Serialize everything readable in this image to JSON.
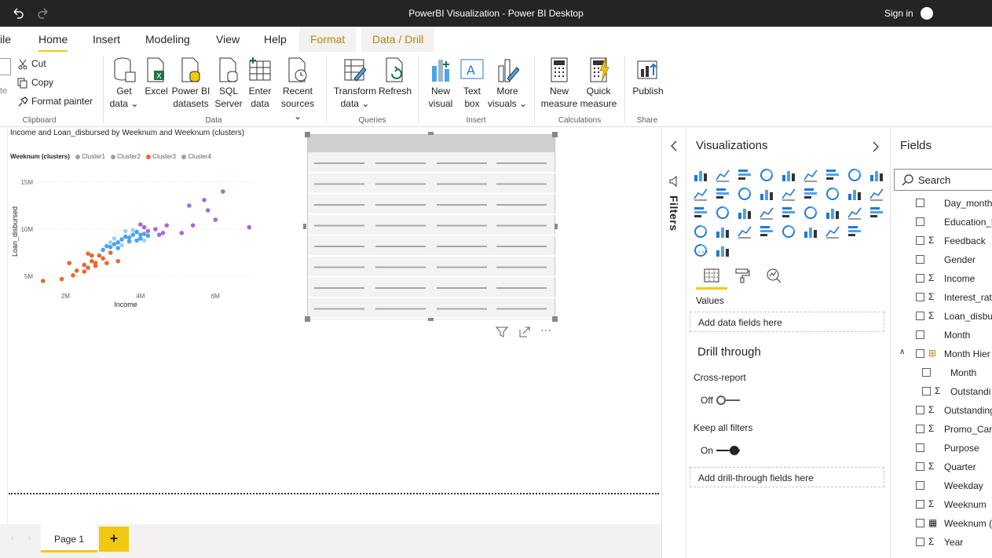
{
  "window": {
    "title": "PowerBI Visualization - Power BI Desktop",
    "sign_in": "Sign in"
  },
  "tabs": {
    "file": "ile",
    "home": "Home",
    "insert": "Insert",
    "modeling": "Modeling",
    "view": "View",
    "help": "Help",
    "format": "Format",
    "data_drill": "Data / Drill"
  },
  "ribbon": {
    "paste": "te",
    "cut": "Cut",
    "copy": "Copy",
    "format_painter": "Format painter",
    "get_data": "Get",
    "get_data2": "data",
    "excel": "Excel",
    "pbi_datasets": "Power BI",
    "pbi_datasets2": "datasets",
    "sql": "SQL",
    "sql2": "Server",
    "enter_data": "Enter",
    "enter_data2": "data",
    "recent": "Recent",
    "recent2": "sources",
    "transform": "Transform",
    "transform2": "data",
    "refresh": "Refresh",
    "new_visual": "New",
    "new_visual2": "visual",
    "text_box": "Text",
    "text_box2": "box",
    "more_visuals": "More",
    "more_visuals2": "visuals",
    "new_measure": "New",
    "new_measure2": "measure",
    "quick_measure": "Quick",
    "quick_measure2": "measure",
    "publish": "Publish",
    "groups": {
      "clipboard": "Clipboard",
      "data": "Data",
      "queries": "Queries",
      "insert": "Insert",
      "calculations": "Calculations",
      "share": "Share"
    }
  },
  "chart": {
    "title": "Income and Loan_disbursed by Weeknum and Weeknum (clusters)",
    "legend_title": "Weeknum (clusters)",
    "legend": [
      "Cluster1",
      "Cluster2",
      "Cluster3",
      "Cluster4"
    ]
  },
  "chart_data": {
    "type": "scatter",
    "title": "Income and Loan_disbursed by Weeknum and Weeknum (clusters)",
    "xlabel": "Income",
    "ylabel": "Loan_disbursed",
    "x_ticks": [
      "2M",
      "4M",
      "6M"
    ],
    "y_ticks": [
      "5M",
      "10M",
      "15M"
    ],
    "xlim": [
      1.3,
      7.0
    ],
    "ylim": [
      3.5,
      16.0
    ],
    "legend_placement": "top-left",
    "series": [
      {
        "name": "Cluster1",
        "color": "#4aa5e8",
        "points": [
          [
            3.1,
            8.2
          ],
          [
            3.3,
            8.4
          ],
          [
            3.4,
            8.6
          ],
          [
            3.5,
            8.9
          ],
          [
            3.2,
            8.1
          ],
          [
            3.6,
            9.2
          ],
          [
            3.7,
            8.7
          ],
          [
            3.8,
            9.4
          ],
          [
            3.9,
            9.7
          ],
          [
            4.0,
            9.0
          ],
          [
            4.1,
            9.5
          ],
          [
            3.7,
            9.1
          ],
          [
            4.2,
            9.3
          ],
          [
            3.9,
            8.8
          ],
          [
            4.0,
            9.4
          ],
          [
            3.0,
            7.8
          ],
          [
            3.4,
            8.0
          ]
        ]
      },
      {
        "name": "Cluster2",
        "color": "#a0d2f5",
        "points": [
          [
            3.3,
            9.0
          ],
          [
            3.6,
            9.8
          ],
          [
            3.8,
            9.9
          ],
          [
            3.2,
            8.6
          ],
          [
            3.5,
            8.3
          ],
          [
            4.1,
            8.8
          ]
        ]
      },
      {
        "name": "Cluster3",
        "color": "#e8692e",
        "points": [
          [
            1.4,
            4.5
          ],
          [
            1.9,
            4.7
          ],
          [
            2.1,
            6.4
          ],
          [
            2.3,
            5.6
          ],
          [
            2.5,
            6.2
          ],
          [
            2.6,
            5.9
          ],
          [
            2.7,
            6.6
          ],
          [
            2.8,
            6.4
          ],
          [
            2.9,
            7.2
          ],
          [
            3.0,
            6.9
          ],
          [
            3.2,
            7.5
          ],
          [
            2.6,
            7.4
          ],
          [
            2.8,
            6.1
          ],
          [
            3.1,
            6.4
          ],
          [
            2.5,
            5.5
          ],
          [
            2.7,
            7.2
          ],
          [
            3.4,
            6.6
          ],
          [
            2.2,
            5.1
          ]
        ]
      },
      {
        "name": "Cluster4",
        "color": "#a66bd3",
        "points": [
          [
            4.0,
            10.5
          ],
          [
            4.2,
            9.8
          ],
          [
            4.4,
            10.0
          ],
          [
            4.6,
            9.6
          ],
          [
            4.7,
            10.4
          ],
          [
            5.1,
            9.6
          ],
          [
            5.4,
            10.4
          ],
          [
            5.3,
            12.5
          ],
          [
            5.8,
            12.0
          ],
          [
            6.0,
            11.0
          ],
          [
            6.2,
            14.0
          ],
          [
            5.7,
            13.1
          ],
          [
            6.9,
            10.2
          ],
          [
            4.1,
            10.2
          ],
          [
            4.5,
            9.4
          ]
        ]
      }
    ]
  },
  "filters": {
    "label": "Filters"
  },
  "viz_pane": {
    "title": "Visualizations",
    "values_label": "Values",
    "add_fields": "Add data fields here",
    "drill_through": "Drill through",
    "cross_report": "Cross-report",
    "cross_report_state": "Off",
    "keep_all_filters": "Keep all filters",
    "keep_state": "On",
    "add_drill": "Add drill-through fields here",
    "more": "···"
  },
  "fields_pane": {
    "title": "Fields",
    "search_placeholder": "Search",
    "items": [
      {
        "name": "Day_month",
        "sigma": false,
        "indent": 0
      },
      {
        "name": "Education_l",
        "sigma": false,
        "indent": 0
      },
      {
        "name": "Feedback",
        "sigma": true,
        "indent": 0
      },
      {
        "name": "Gender",
        "sigma": false,
        "indent": 0
      },
      {
        "name": "Income",
        "sigma": true,
        "indent": 0
      },
      {
        "name": "Interest_rate",
        "sigma": true,
        "indent": 0
      },
      {
        "name": "Loan_disbu",
        "sigma": true,
        "indent": 0
      },
      {
        "name": "Month",
        "sigma": false,
        "indent": 0
      },
      {
        "name": "Month Hier",
        "sigma": false,
        "indent": 0,
        "hier": true
      },
      {
        "name": "Month",
        "sigma": false,
        "indent": 1
      },
      {
        "name": "Outstandi",
        "sigma": true,
        "indent": 1
      },
      {
        "name": "Outstanding",
        "sigma": true,
        "indent": 0
      },
      {
        "name": "Promo_Cam",
        "sigma": true,
        "indent": 0
      },
      {
        "name": "Purpose",
        "sigma": false,
        "indent": 0
      },
      {
        "name": "Quarter",
        "sigma": true,
        "indent": 0
      },
      {
        "name": "Weekday",
        "sigma": false,
        "indent": 0
      },
      {
        "name": "Weeknum",
        "sigma": true,
        "indent": 0
      },
      {
        "name": "Weeknum (",
        "sigma": false,
        "indent": 0,
        "table": true
      },
      {
        "name": "Year",
        "sigma": true,
        "indent": 0
      }
    ]
  },
  "pages": {
    "page1": "Page 1",
    "add": "+"
  }
}
